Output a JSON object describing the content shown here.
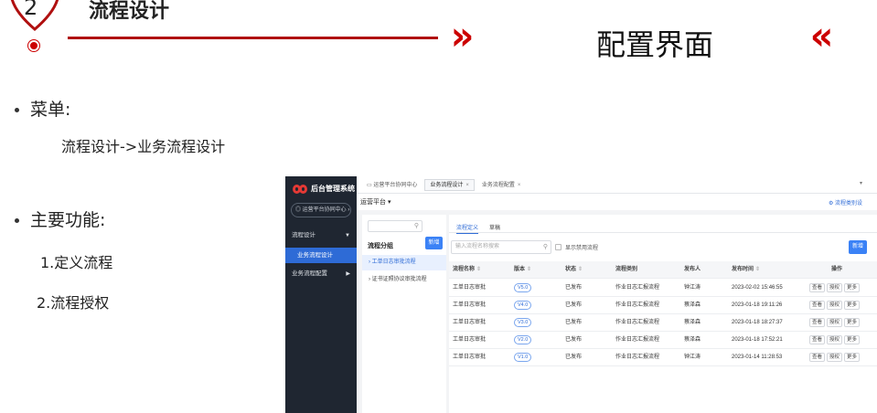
{
  "header": {
    "section_number": "2",
    "section_title": "流程设计",
    "subtitle": "配置界面",
    "chevron_right": "»",
    "chevron_left": "«"
  },
  "bullets": {
    "menu_label": "菜单:",
    "menu_path": "流程设计->业务流程设计",
    "features_label": "主要功能:",
    "features": [
      "1.定义流程",
      "2.流程授权"
    ]
  },
  "app": {
    "logo_text": "后台管理系统",
    "system_select": "运营平台协同中心",
    "sidebar": {
      "items": [
        {
          "label": "流程设计"
        },
        {
          "label": "业务流程设计"
        },
        {
          "label": "业务流程配置"
        }
      ]
    },
    "tabs": [
      {
        "label": "运营平台协同中心"
      },
      {
        "label": "业务流程设计"
      },
      {
        "label": "业务流程配置"
      }
    ],
    "platform_label": "运营平台",
    "platform_right": "流程类别设",
    "left_panel": {
      "title": "流程分组",
      "new_label": "新增",
      "groups": [
        "工单日志审批流程",
        "证书证照协议审批流程"
      ]
    },
    "right_panel": {
      "tabs": [
        "流程定义",
        "草稿"
      ],
      "search_placeholder": "输入流程名称搜索",
      "show_disabled_label": "显示禁用流程",
      "new_label": "新增",
      "columns": [
        "流程名称",
        "版本",
        "状态",
        "流程类别",
        "发布人",
        "发布时间",
        "操作"
      ],
      "rows": [
        {
          "name": "工单日志审批",
          "version": "V5.0",
          "status": "已发布",
          "category": "作业日志汇报流程",
          "publisher": "钟江涛",
          "time": "2023-02-02 15:46:55"
        },
        {
          "name": "工单日志审批",
          "version": "V4.0",
          "status": "已发布",
          "category": "作业日志汇报流程",
          "publisher": "蔡泽森",
          "time": "2023-01-18 19:11:26"
        },
        {
          "name": "工单日志审批",
          "version": "V3.0",
          "status": "已发布",
          "category": "作业日志汇报流程",
          "publisher": "蔡泽森",
          "time": "2023-01-18 18:27:37"
        },
        {
          "name": "工单日志审批",
          "version": "V2.0",
          "status": "已发布",
          "category": "作业日志汇报流程",
          "publisher": "蔡泽森",
          "time": "2023-01-18 17:52:21"
        },
        {
          "name": "工单日志审批",
          "version": "V1.0",
          "status": "已发布",
          "category": "作业日志汇报流程",
          "publisher": "钟江涛",
          "time": "2023-01-14 11:28:53"
        }
      ],
      "actions": [
        "查看",
        "授权",
        "更多"
      ]
    }
  },
  "colors": {
    "accent_red": "#c00000",
    "sidebar_bg": "#1f2631",
    "primary_blue": "#3b82f6"
  }
}
